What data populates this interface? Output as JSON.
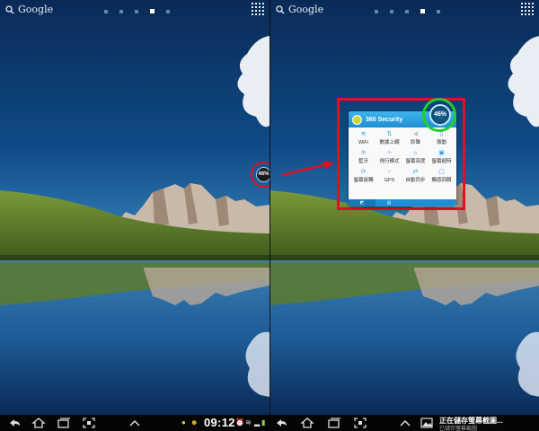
{
  "search": {
    "label": "Google"
  },
  "home_pages": {
    "count": 5,
    "active_index": 3
  },
  "widget": {
    "brand": "360 Security",
    "percent": "46%",
    "toggles": [
      {
        "label": "WiFi",
        "icon": "wifi-icon",
        "glyph": "≋",
        "active": true
      },
      {
        "label": "數據上網",
        "icon": "data-transfer-icon",
        "glyph": "⇅",
        "active": true
      },
      {
        "label": "鈴聲",
        "icon": "ringer-icon",
        "glyph": "◀",
        "active": false
      },
      {
        "label": "振動",
        "icon": "vibrate-icon",
        "glyph": "▯",
        "active": true
      },
      {
        "label": "藍牙",
        "icon": "bluetooth-icon",
        "glyph": "✱",
        "active": false
      },
      {
        "label": "飛行模式",
        "icon": "airplane-icon",
        "glyph": "✈",
        "active": false
      },
      {
        "label": "螢幕亮度",
        "icon": "brightness-icon",
        "glyph": "☼",
        "active": true
      },
      {
        "label": "螢幕超時",
        "icon": "screen-timeout-icon",
        "glyph": "▣",
        "active": true
      },
      {
        "label": "螢幕旋轉",
        "icon": "rotate-icon",
        "glyph": "⟳",
        "active": true
      },
      {
        "label": "GPS",
        "icon": "gps-icon",
        "glyph": "⌖",
        "active": false
      },
      {
        "label": "自動同步",
        "icon": "sync-icon",
        "glyph": "⇄",
        "active": true
      },
      {
        "label": "觸感回饋",
        "icon": "haptic-feedback-icon",
        "glyph": "▢",
        "active": true
      }
    ]
  },
  "floating_badge": {
    "text": "46%"
  },
  "status_bar": {
    "time": "09:12"
  },
  "notification": {
    "title": "正在儲存螢幕截圖...",
    "subtitle": "已儲存螢幕截圖"
  },
  "colors": {
    "highlight_red": "#e01020",
    "highlight_green": "#1fd02a",
    "widget_blue": "#1e8fd4"
  }
}
